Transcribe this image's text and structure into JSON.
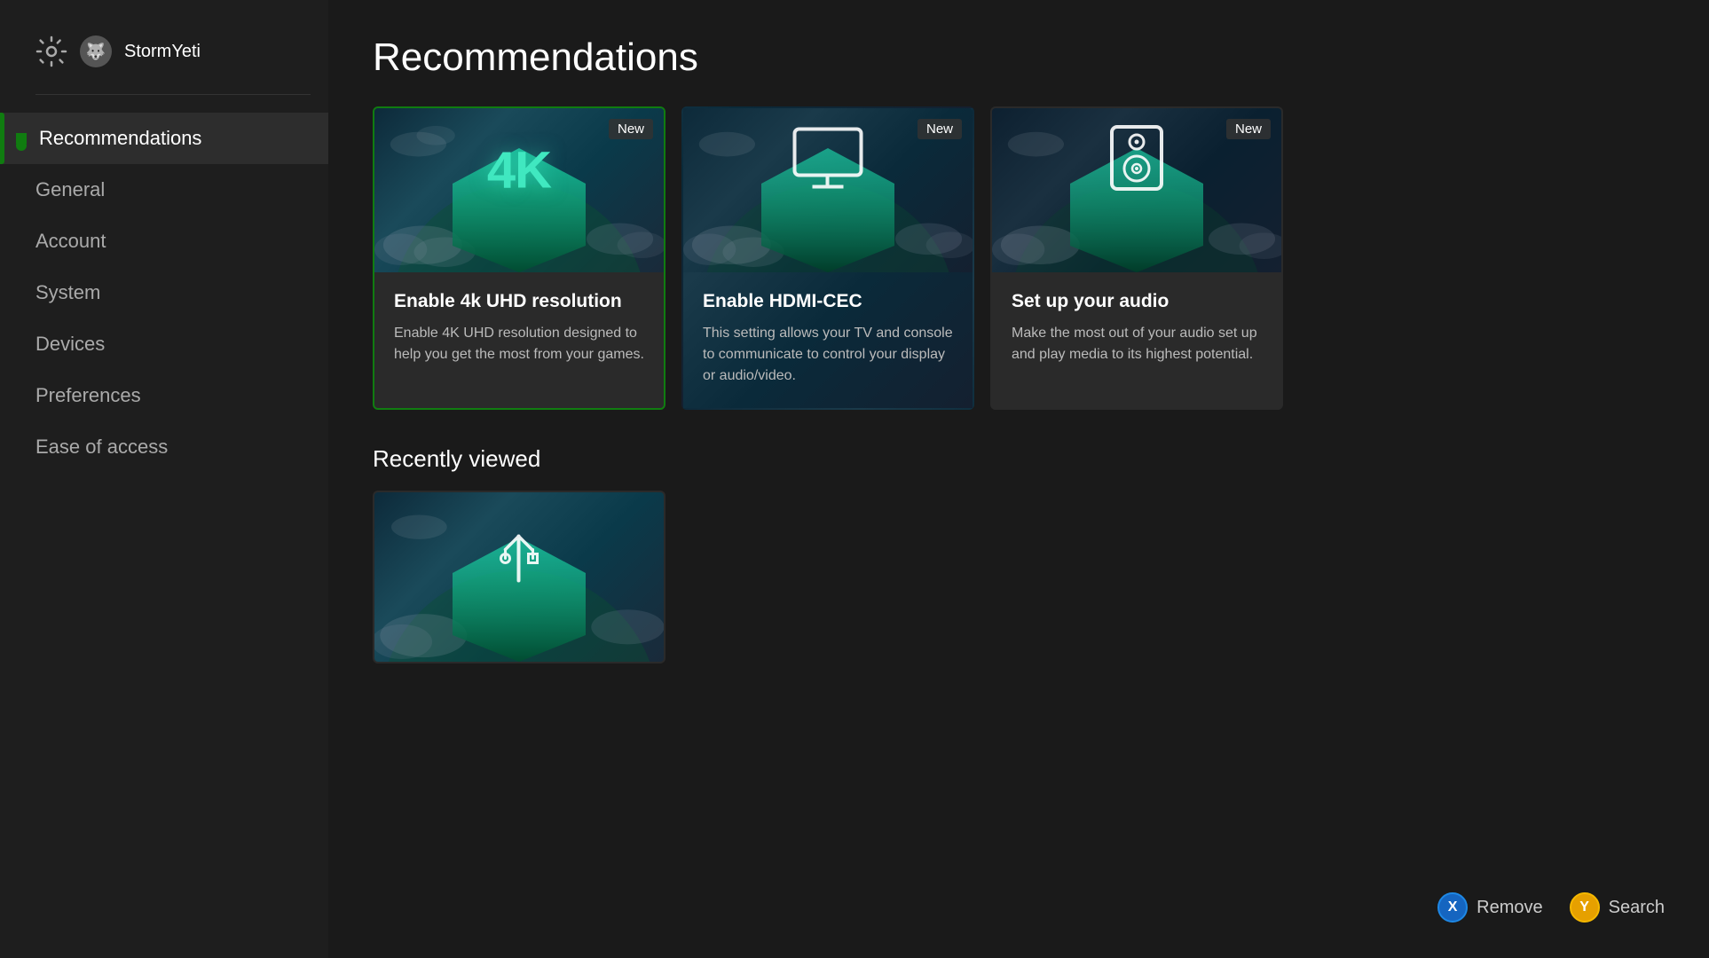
{
  "sidebar": {
    "username": "StormYeti",
    "items": [
      {
        "id": "recommendations",
        "label": "Recommendations",
        "active": true
      },
      {
        "id": "general",
        "label": "General",
        "active": false
      },
      {
        "id": "account",
        "label": "Account",
        "active": false
      },
      {
        "id": "system",
        "label": "System",
        "active": false
      },
      {
        "id": "devices",
        "label": "Devices",
        "active": false
      },
      {
        "id": "preferences",
        "label": "Preferences",
        "active": false
      },
      {
        "id": "ease-of-access",
        "label": "Ease of access",
        "active": false
      }
    ]
  },
  "main": {
    "page_title": "Recommendations",
    "recommendation_cards": [
      {
        "id": "4k",
        "badge": "New",
        "title": "Enable 4k UHD resolution",
        "description": "Enable 4K UHD resolution designed to help you get the most from your games.",
        "selected": true,
        "icon_text": "4K"
      },
      {
        "id": "hdmi-cec",
        "badge": "New",
        "title": "Enable HDMI-CEC",
        "description": "This setting allows your TV and console to communicate to control your display or audio/video.",
        "selected": false,
        "icon_text": "monitor"
      },
      {
        "id": "audio",
        "badge": "New",
        "title": "Set up your audio",
        "description": "Make the most out of your audio set up and play media to its highest potential.",
        "selected": false,
        "icon_text": "speaker"
      }
    ],
    "recently_viewed_title": "Recently viewed",
    "recently_viewed": [
      {
        "id": "recent-1",
        "icon_text": "usb"
      }
    ]
  },
  "bottom_bar": {
    "remove_button": "X",
    "remove_label": "Remove",
    "search_button": "Y",
    "search_label": "Search"
  }
}
